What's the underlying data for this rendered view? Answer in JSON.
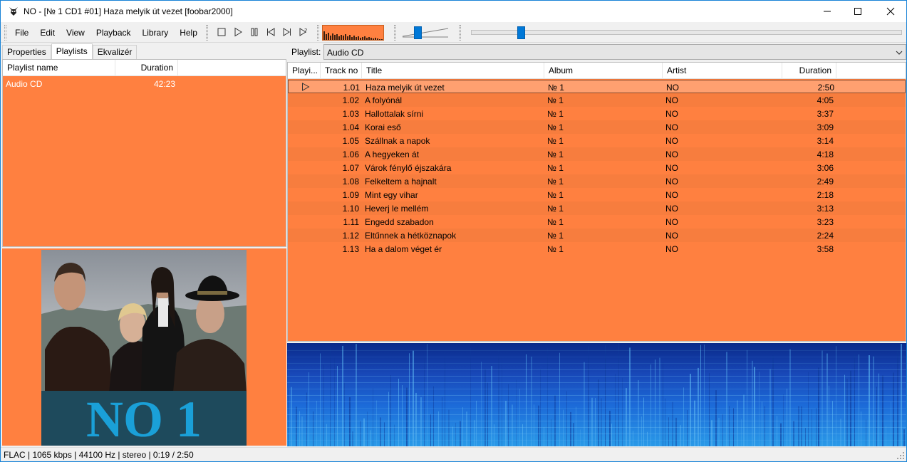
{
  "window": {
    "title": "NO - [№ 1 CD1 #01] Haza melyik út vezet  [foobar2000]"
  },
  "menu": [
    "File",
    "Edit",
    "View",
    "Playback",
    "Library",
    "Help"
  ],
  "transport": [
    "stop",
    "play",
    "pause",
    "previous",
    "next",
    "random"
  ],
  "volume_level": 0.3,
  "seek_position": {
    "elapsed": "0:19",
    "total": "2:50",
    "fraction": 0.11
  },
  "left_tabs": [
    "Properties",
    "Playlists",
    "Ekvalizér"
  ],
  "left_tabs_active": "Playlists",
  "playlists_panel": {
    "columns": [
      "Playlist name",
      "Duration"
    ],
    "rows": [
      {
        "name": "Audio CD",
        "duration": "42:23"
      }
    ]
  },
  "album_cover": {
    "title_text": "NO 1"
  },
  "playlist_selector": {
    "label": "Playlist:",
    "value": "Audio CD"
  },
  "playlist_view": {
    "columns": [
      "Playi...",
      "Track no",
      "Title",
      "Album",
      "Artist",
      "Duration"
    ],
    "tracks": [
      {
        "no": "1.01",
        "title": "Haza melyik út vezet",
        "album": "№ 1",
        "artist": "NO",
        "duration": "2:50"
      },
      {
        "no": "1.02",
        "title": "A folyónál",
        "album": "№ 1",
        "artist": "NO",
        "duration": "4:05"
      },
      {
        "no": "1.03",
        "title": "Hallottalak sírni",
        "album": "№ 1",
        "artist": "NO",
        "duration": "3:37"
      },
      {
        "no": "1.04",
        "title": "Korai eső",
        "album": "№ 1",
        "artist": "NO",
        "duration": "3:09"
      },
      {
        "no": "1.05",
        "title": "Szállnak a napok",
        "album": "№ 1",
        "artist": "NO",
        "duration": "3:14"
      },
      {
        "no": "1.06",
        "title": "A hegyeken át",
        "album": "№ 1",
        "artist": "NO",
        "duration": "4:18"
      },
      {
        "no": "1.07",
        "title": "Várok fénylő éjszakára",
        "album": "№ 1",
        "artist": "NO",
        "duration": "3:06"
      },
      {
        "no": "1.08",
        "title": "Felkeltem a hajnalt",
        "album": "№ 1",
        "artist": "NO",
        "duration": "2:49"
      },
      {
        "no": "1.09",
        "title": "Mint egy vihar",
        "album": "№ 1",
        "artist": "NO",
        "duration": "2:18"
      },
      {
        "no": "1.10",
        "title": "Heverj le mellém",
        "album": "№ 1",
        "artist": "NO",
        "duration": "3:13"
      },
      {
        "no": "1.11",
        "title": "Engedd szabadon",
        "album": "№ 1",
        "artist": "NO",
        "duration": "3:23"
      },
      {
        "no": "1.12",
        "title": "Eltűnnek a hétköznapok",
        "album": "№ 1",
        "artist": "NO",
        "duration": "2:24"
      },
      {
        "no": "1.13",
        "title": "Ha a dalom véget ér",
        "album": "№ 1",
        "artist": "NO",
        "duration": "3:58"
      }
    ]
  },
  "status_bar": "FLAC | 1065 kbps | 44100 Hz | stereo | 0:19 / 2:50",
  "colors": {
    "playlist_bg": "#ff8040",
    "playing_row": "#ffa070",
    "accent": "#0078d7",
    "spectrogram_bg": "#1a56c8"
  }
}
